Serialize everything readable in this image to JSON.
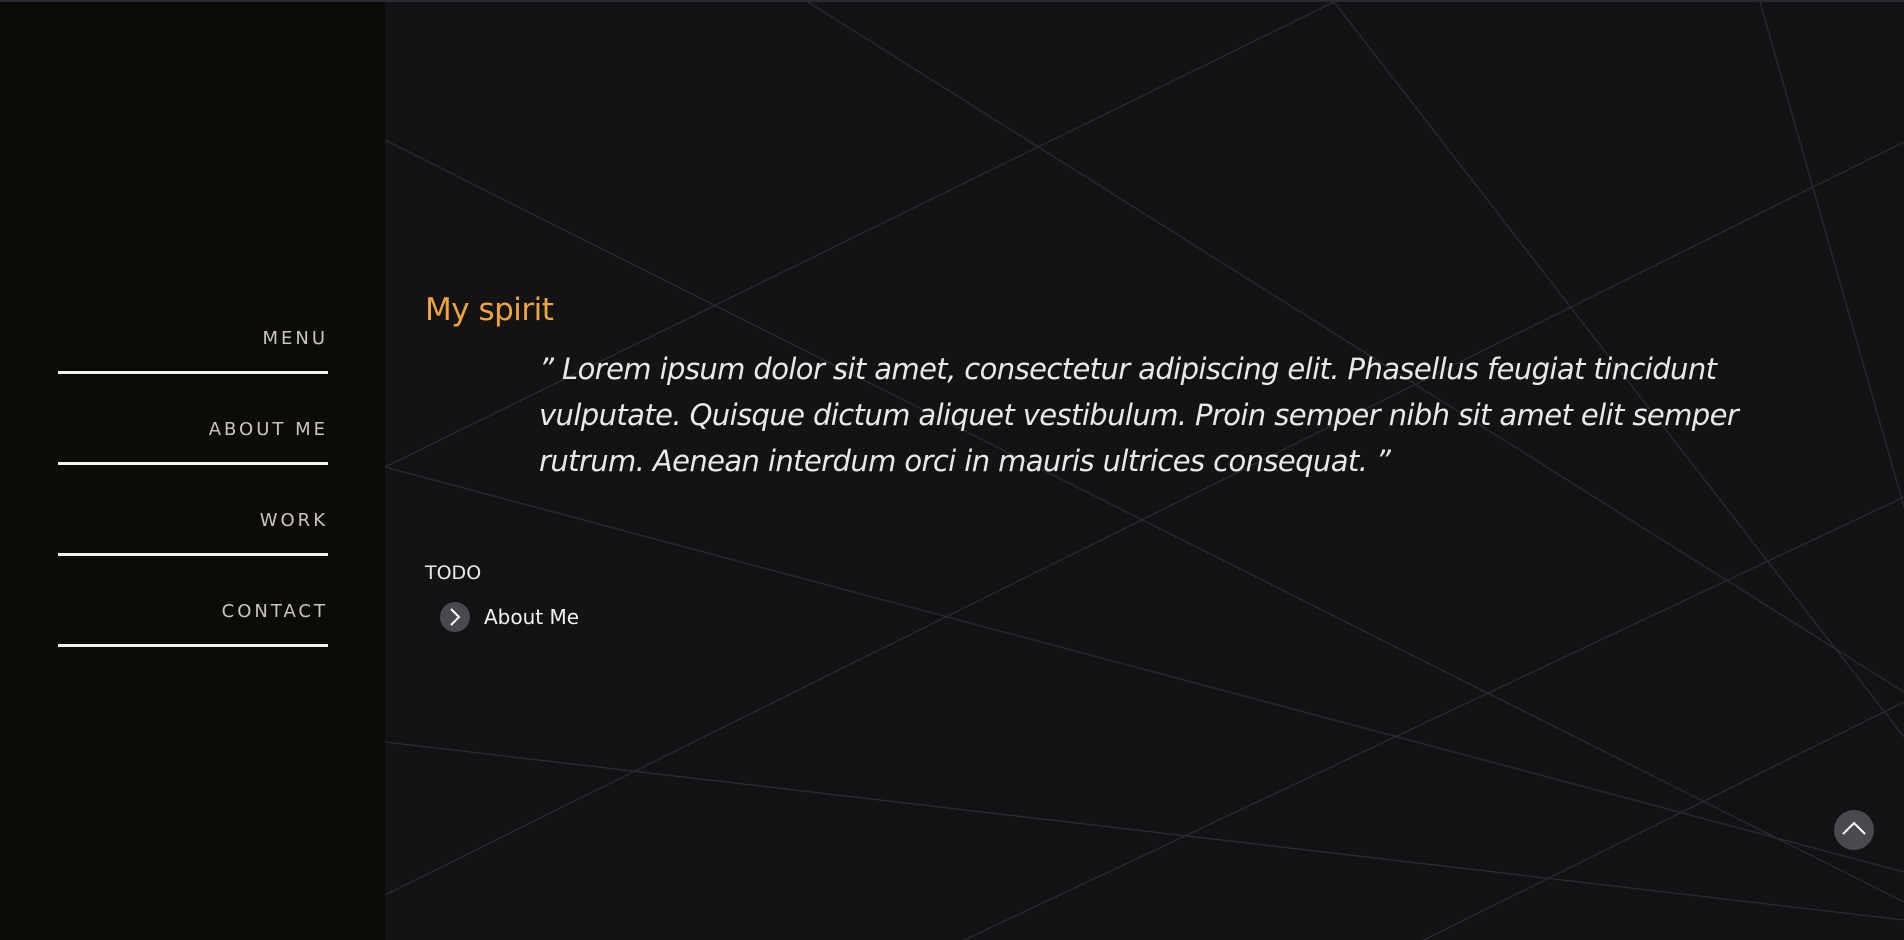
{
  "sidebar": {
    "items": [
      {
        "label": "MENU"
      },
      {
        "label": "ABOUT ME"
      },
      {
        "label": "WORK"
      },
      {
        "label": "CONTACT"
      }
    ]
  },
  "main": {
    "title": "My spirit",
    "quote": "” Lorem ipsum dolor sit amet, consectetur adipiscing elit. Phasellus feugiat tincidunt vulputate. Quisque dictum aliquet vestibulum. Proin semper nibh sit amet elit semper rutrum. Aenean interdum orci in mauris ultrices consequat. ”",
    "todo_title": "TODO",
    "todo_link": {
      "label": "About Me",
      "icon": "chevron-right-icon"
    }
  },
  "scroll_top": {
    "icon": "chevron-up-icon"
  },
  "colors": {
    "sidebar_bg": "#0c0b07",
    "page_bg": "#131316",
    "accent": "#f0a43a",
    "nav_text": "#c9c6bd"
  }
}
